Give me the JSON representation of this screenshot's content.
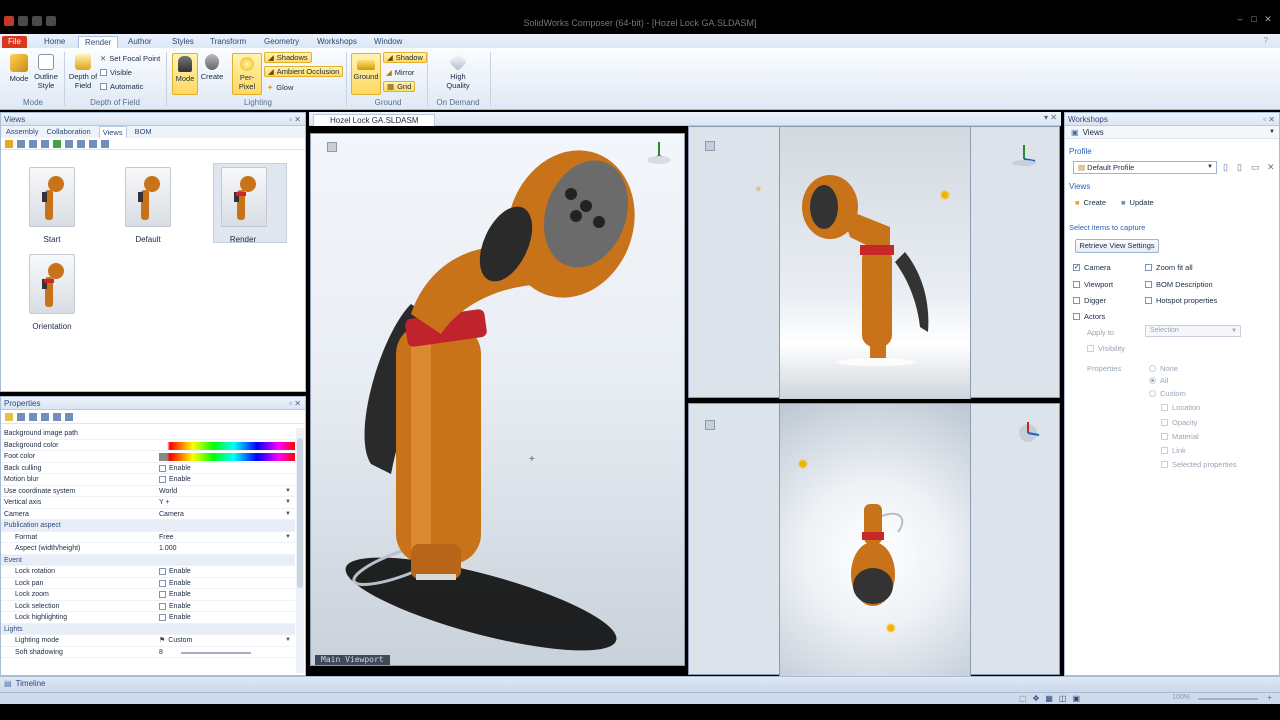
{
  "app": {
    "title": "SolidWorks Composer (64-bit) - [Hozel Lock GA.SLDASM]"
  },
  "ribbon": {
    "tabs": [
      "File",
      "Home",
      "Render",
      "Author",
      "Styles",
      "Transform",
      "Geometry",
      "Workshops",
      "Window"
    ],
    "mode": {
      "mode": "Mode",
      "outline_style": "Outline Style",
      "group": "Mode"
    },
    "dof": {
      "depth_of_field": "Depth of Field",
      "set_focal_point": "Set Focal Point",
      "visible": "Visible",
      "automatic": "Automatic",
      "group": "Depth of Field"
    },
    "lighting": {
      "mode": "Mode",
      "create": "Create",
      "per_pixel": "Per-Pixel",
      "shadows": "Shadows",
      "ambient_occlusion": "Ambient Occlusion",
      "glow": "Glow",
      "group": "Lighting"
    },
    "ground": {
      "ground": "Ground",
      "shadow": "Shadow",
      "mirror": "Mirror",
      "grid": "Grid",
      "group": "Ground"
    },
    "ondemand": {
      "high_quality": "High Quality",
      "group": "On Demand"
    }
  },
  "views_panel": {
    "title": "Views",
    "tabs": [
      "Assembly",
      "Collaboration",
      "Views",
      "BOM"
    ],
    "thumbs": [
      "Start",
      "Default",
      "Render",
      "Orientation"
    ]
  },
  "properties_panel": {
    "title": "Properties",
    "rows": [
      {
        "k": "Background image path",
        "v": ""
      },
      {
        "k": "Background color",
        "v": ""
      },
      {
        "k": "Foot color",
        "v": ""
      },
      {
        "k": "Back culling",
        "v": "Enable"
      },
      {
        "k": "Motion blur",
        "v": "Enable"
      },
      {
        "k": "Use coordinate system",
        "v": "World"
      },
      {
        "k": "Vertical axis",
        "v": "Y +"
      },
      {
        "k": "Camera",
        "v": "Camera"
      },
      {
        "k": "Publication aspect",
        "v": ""
      },
      {
        "k": "Format",
        "v": "Free"
      },
      {
        "k": "Aspect (width/height)",
        "v": "1.000"
      },
      {
        "k": "Event",
        "v": ""
      },
      {
        "k": "Lock rotation",
        "v": "Enable"
      },
      {
        "k": "Lock pan",
        "v": "Enable"
      },
      {
        "k": "Lock zoom",
        "v": "Enable"
      },
      {
        "k": "Lock selection",
        "v": "Enable"
      },
      {
        "k": "Lock highlighting",
        "v": "Enable"
      },
      {
        "k": "Lights",
        "v": ""
      },
      {
        "k": "Lighting mode",
        "v": "Custom"
      },
      {
        "k": "Soft shadowing",
        "v": "8"
      }
    ]
  },
  "viewport": {
    "title": "Hozel Lock GA.SLDASM",
    "main_label": "Main Viewport"
  },
  "workshops": {
    "title": "Workshops",
    "views": "Views",
    "profile_label": "Profile",
    "profile": "Default Profile",
    "views_label": "Views",
    "create": "Create",
    "update": "Update",
    "select_items": "Select items to capture",
    "retrieve": "Retrieve View Settings",
    "camera": "Camera",
    "zoom_fit_all": "Zoom fit all",
    "viewport": "Viewport",
    "bom_desc": "BOM Description",
    "digger": "Digger",
    "hotspot": "Hotspot properties",
    "actors": "Actors",
    "apply_to": "Apply to",
    "selection": "Selection",
    "visibility": "Visibility",
    "properties": "Properties",
    "none": "None",
    "all": "All",
    "custom": "Custom",
    "location": "Location",
    "opacity": "Opacity",
    "material": "Material",
    "link": "Link",
    "selected_props": "Selected properties"
  },
  "statusbar": {
    "timeline": "Timeline",
    "zoom": "100%"
  }
}
